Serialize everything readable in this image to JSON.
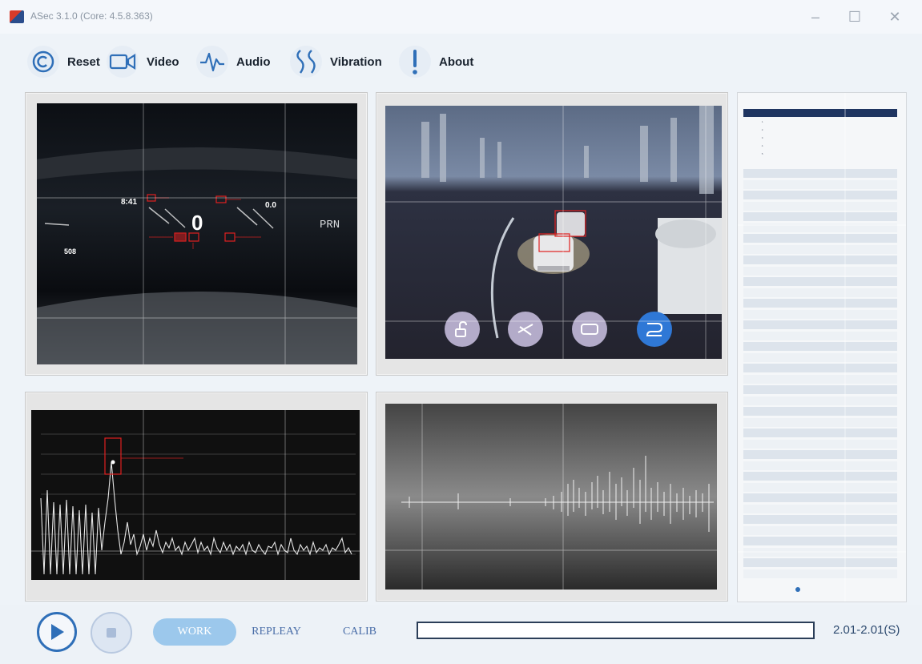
{
  "window": {
    "title": "ASec 3.1.0 (Core: 4.5.8.363)",
    "controls": {
      "minimize": "–",
      "maximize": "☐",
      "close": "✕"
    }
  },
  "toolbar": {
    "items": [
      {
        "label": "Reset",
        "icon": "copyright-icon"
      },
      {
        "label": "Video",
        "icon": "video-camera-icon"
      },
      {
        "label": "Audio",
        "icon": "audio-wave-icon"
      },
      {
        "label": "Vibration",
        "icon": "vibration-icon"
      },
      {
        "label": "About",
        "icon": "exclamation-icon"
      }
    ]
  },
  "panels": {
    "dashboard_video": {
      "cluster_left": "8:41",
      "cluster_right": "0.0",
      "gear": "PRN",
      "speed": "0",
      "odometer": "508"
    },
    "adas_view": {},
    "spectrum": {},
    "waveform": {}
  },
  "side_table": {
    "rows": [
      {
        "no": "1."
      },
      {
        "no": "2."
      },
      {
        "no": "3."
      },
      {
        "no": "4."
      },
      {
        "no": "5."
      }
    ]
  },
  "bottom": {
    "modes": [
      "WORK",
      "REPLEAY",
      "CALIB"
    ],
    "active_mode": "WORK",
    "progress": 0.0,
    "time_readout": "2.01-2.01(S)"
  },
  "colors": {
    "accent": "#2f6fb8",
    "work_button": "#9cc8ec",
    "panel_dark": "#1a1a1a"
  }
}
